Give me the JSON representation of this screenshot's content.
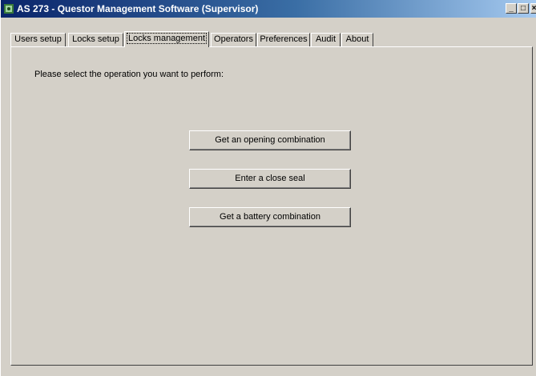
{
  "window": {
    "title": "AS 273 - Questor Management Software (Supervisor)",
    "minimize_glyph": "_",
    "maximize_glyph": "□",
    "close_glyph": "×"
  },
  "tabs": [
    {
      "label": "Users setup"
    },
    {
      "label": "Locks setup"
    },
    {
      "label": "Locks management",
      "active": true
    },
    {
      "label": "Operators"
    },
    {
      "label": "Preferences"
    },
    {
      "label": "Audit"
    },
    {
      "label": "About"
    }
  ],
  "panel": {
    "prompt": "Please select the operation you want to perform:",
    "buttons": {
      "opening": "Get an opening combination",
      "close_seal": "Enter a close seal",
      "battery": "Get a battery combination"
    }
  }
}
